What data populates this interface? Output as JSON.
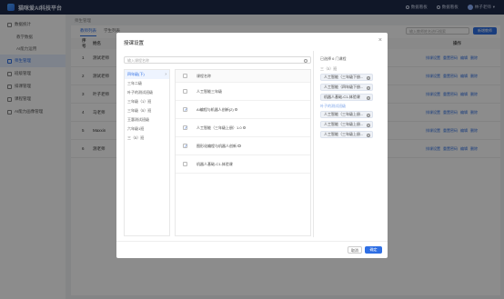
{
  "app": {
    "title": "猫咪爱AI科技平台"
  },
  "topbar": {
    "link1": "数据看板",
    "link2": "数据看板",
    "user": "林子老师"
  },
  "sidebar": {
    "items": [
      {
        "label": "数据统计",
        "active": false,
        "sub": false
      },
      {
        "label": "教学数据",
        "active": false,
        "sub": true
      },
      {
        "label": "AI能力运用",
        "active": false,
        "sub": true
      },
      {
        "label": "师生管理",
        "active": true,
        "sub": false
      },
      {
        "label": "班级管理",
        "active": false,
        "sub": false
      },
      {
        "label": "排课管理",
        "active": false,
        "sub": false
      },
      {
        "label": "课程管理",
        "active": false,
        "sub": false
      },
      {
        "label": "AI能力画像管理",
        "active": false,
        "sub": false
      }
    ]
  },
  "main": {
    "breadcrumb": "师生管理",
    "tabs": [
      "教师列表",
      "学生列表"
    ],
    "search_placeholder": "输入教师姓名进行搜索",
    "add_button": "新增教师",
    "headers": [
      "序号",
      "姓名",
      "操作"
    ],
    "rows": [
      {
        "no": "1",
        "name": "测试老师",
        "date": "2023-09-14 16:08:58",
        "ops": [
          "排课设置",
          "重置密码",
          "编辑",
          "删除"
        ]
      },
      {
        "no": "2",
        "name": "测试老师",
        "date": "2023-09-14 16:08:42",
        "ops": [
          "排课设置",
          "重置密码",
          "编辑",
          "删除"
        ]
      },
      {
        "no": "3",
        "name": "叶子老师",
        "date": "2023-09-14 14:21:16",
        "ops": [
          "排课设置",
          "重置密码",
          "编辑",
          "删除"
        ]
      },
      {
        "no": "4",
        "name": "马老师",
        "date": "2023-09-14 14:18:17",
        "ops": [
          "排课设置",
          "重置密码",
          "编辑",
          "删除"
        ]
      },
      {
        "no": "5",
        "name": "Maxxin",
        "date": "2023-09-14 14:02:33",
        "ops": [
          "排课设置",
          "重置密码",
          "编辑",
          "删除"
        ]
      },
      {
        "no": "6",
        "name": "测老师",
        "date": "2023-08-27 22:47:42",
        "ops": [
          "排课设置",
          "重置密码",
          "编辑",
          "删除"
        ]
      }
    ]
  },
  "dialog": {
    "title": "授课设置",
    "search_placeholder": "输入课程名称",
    "categories": [
      {
        "label": "四年级(下)",
        "active": true
      },
      {
        "label": "三年二级",
        "active": false
      },
      {
        "label": "叶子的测试班级",
        "active": false
      },
      {
        "label": "三年级（1）班",
        "active": false
      },
      {
        "label": "三年级（5）班",
        "active": false
      },
      {
        "label": "王惠测试班级",
        "active": false
      },
      {
        "label": "六年级1班",
        "active": false
      },
      {
        "label": "三（5）班",
        "active": false
      }
    ],
    "course_header": "课程名称",
    "courses": [
      {
        "label": "人工智能三年级",
        "checked": false,
        "info": false
      },
      {
        "label": "AI编程与机器人创新(2)",
        "checked": true,
        "info": true
      },
      {
        "label": "人工智能（三年级上册）1.0",
        "checked": true,
        "info": true
      },
      {
        "label": "图形化编程与机器人创新",
        "checked": true,
        "info": true
      },
      {
        "label": "机器人基础-C1-体验课",
        "checked": false,
        "info": false
      }
    ],
    "selected_title": "已选择 6 门课程",
    "groups": [
      {
        "label": "三（5）班",
        "alt": false,
        "tags": [
          "人工智能（三年级下册...",
          "人工智能（四年级下册...",
          "机器人基础-C1-体验课"
        ]
      },
      {
        "label": "叶子的测试班级",
        "alt": true,
        "tags": [
          "人工智能（三年级上册...",
          "人工智能（三年级上册...",
          "人工智能（三年级上册..."
        ]
      }
    ],
    "cancel": "取消",
    "confirm": "确定"
  }
}
